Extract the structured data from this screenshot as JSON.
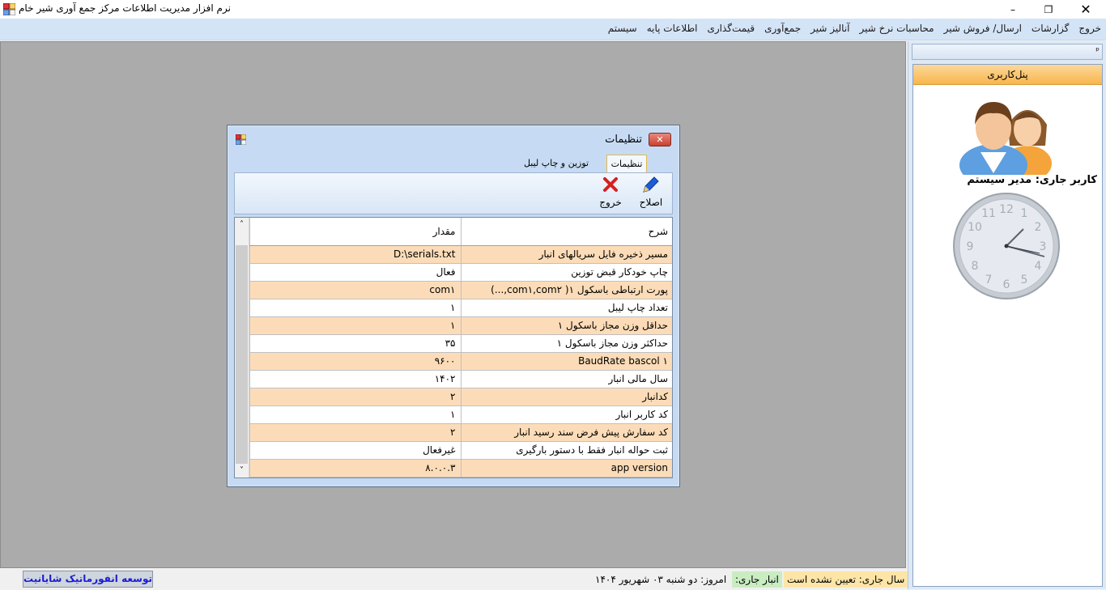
{
  "window": {
    "title": "نرم افزار مدیریت اطلاعات مرکز جمع آوری شیر خام",
    "minimize": "–",
    "restore": "❐",
    "close": "✕"
  },
  "menu": [
    "سیستم",
    "اطلاعات پایه",
    "قیمت‌گذاری",
    "جمع‌آوری",
    "آنالیز شیر",
    "محاسبات نرخ شیر",
    "ارسال/ فروش شیر",
    "گزارشات",
    "خروج"
  ],
  "side_panel": {
    "pin": "ᵖ",
    "header": "پنل‌کاربری",
    "current_user": "کاربر جاری: مدیر سیستم",
    "clock_numbers": [
      "12",
      "1",
      "2",
      "3",
      "4",
      "5",
      "6",
      "7",
      "8",
      "9",
      "10",
      "11"
    ]
  },
  "status": {
    "brand": "توسعه انفورماتیک شایانیت",
    "year": "سال جاری: تعیین نشده است",
    "store": "انبار جاری:",
    "today": "امروز: دو شنبه ۰۳ شهریور ۱۴۰۴"
  },
  "dialog": {
    "title": "تنظیمات",
    "close": "✕",
    "tabs": {
      "settings": "تنظیمات",
      "weighing": "توزین و چاپ لیبل"
    },
    "toolbar": {
      "edit": "اصلاح",
      "exit": "خروج"
    },
    "grid": {
      "headers": {
        "desc": "شرح",
        "value": "مقدار"
      },
      "scroll_up": "˄",
      "scroll_down": "˅",
      "rows": [
        {
          "desc": "مسیر ذخیره فایل سریالهای انبار",
          "value": "D:\\serials.txt"
        },
        {
          "desc": "چاپ خودکار قبض توزین",
          "value": "فعال"
        },
        {
          "desc": "پورت ارتباطی باسکول ۱( com۱,com۲,...)",
          "value": "com۱"
        },
        {
          "desc": "تعداد چاپ لیبل",
          "value": "۱"
        },
        {
          "desc": "حداقل وزن مجاز باسکول ۱",
          "value": "۱"
        },
        {
          "desc": "حداکثر وزن مجاز باسکول ۱",
          "value": "۳۵"
        },
        {
          "desc": "BaudRate bascol ۱",
          "value": "۹۶۰۰"
        },
        {
          "desc": "سال مالی انبار",
          "value": "۱۴۰۲"
        },
        {
          "desc": "کدانبار",
          "value": "۲"
        },
        {
          "desc": "کد کاربر انبار",
          "value": "۱"
        },
        {
          "desc": "کد سفارش پیش فرض سند رسید انبار",
          "value": "۲"
        },
        {
          "desc": "ثبت حواله انبار فقط با دستور بارگیری",
          "value": "غیرفعال"
        },
        {
          "desc": "app version",
          "value": "۸.۰.۰.۳"
        }
      ]
    }
  },
  "colors": {
    "menu_bar": "#d4e4f7",
    "mdi_background": "#ababab",
    "row_highlight": "#fcdcb8",
    "panel_header": "#f7b64d",
    "close_button": "#c9402f"
  }
}
